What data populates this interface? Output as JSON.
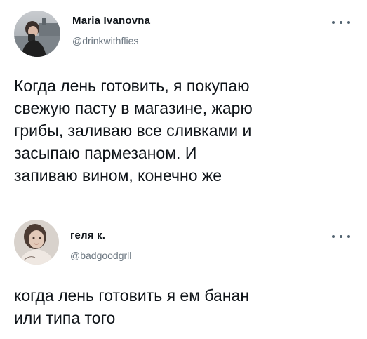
{
  "tweets": [
    {
      "name": "Maria Ivanovna",
      "handle": "@drinkwithflies_",
      "text": "Когда лень готовить, я покупаю\nсвежую пасту в магазине, жарю\nгрибы, заливаю все сливками и\nзасыпаю пармезаном. И\nзапиваю вином, конечно же",
      "avatar_icon": "profile-photo"
    },
    {
      "name": "геля к.",
      "handle": "@badgoodgrll",
      "text": "когда лень готовить я ем банан\nили типа того",
      "avatar_icon": "profile-photo"
    }
  ],
  "colors": {
    "text": "#0f1419",
    "secondary_text": "#6b7680",
    "background": "#ffffff"
  }
}
